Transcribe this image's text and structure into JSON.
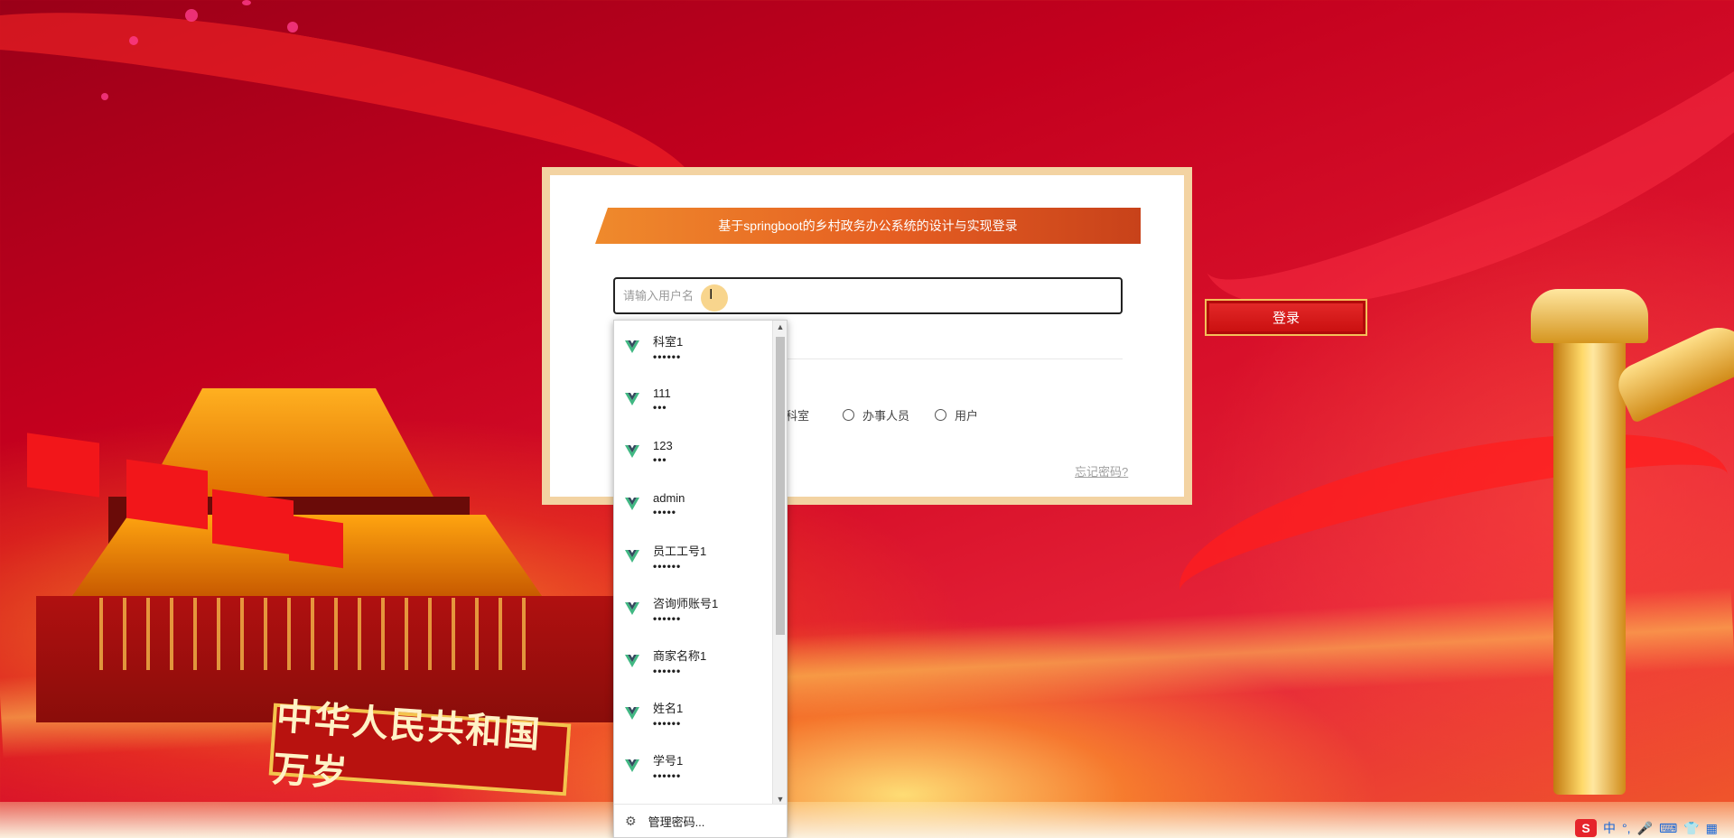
{
  "card": {
    "title": "基于springboot的乡村政务办公系统的设计与实现登录",
    "username_placeholder": "请输入用户名",
    "forgot_password": "忘记密码?",
    "roles": {
      "partial_visible": "科室",
      "options": [
        "办事人员",
        "用户"
      ]
    }
  },
  "login_button": "登录",
  "autofill": {
    "items": [
      {
        "name": "科室1",
        "password_mask": "••••••"
      },
      {
        "name": "111",
        "password_mask": "•••"
      },
      {
        "name": "123",
        "password_mask": "•••"
      },
      {
        "name": "admin",
        "password_mask": "•••••"
      },
      {
        "name": "员工工号1",
        "password_mask": "••••••"
      },
      {
        "name": "咨询师账号1",
        "password_mask": "••••••"
      },
      {
        "name": "商家名称1",
        "password_mask": "••••••"
      },
      {
        "name": "姓名1",
        "password_mask": "••••••"
      },
      {
        "name": "学号1",
        "password_mask": "••••••"
      }
    ],
    "manage_label": "管理密码...",
    "icon_color": "#41b883"
  },
  "background": {
    "plaque_text": "中华人民共和国万岁"
  },
  "tray": {
    "ime_logo": "S",
    "ime_lang": "中",
    "ime_punct": "°,"
  },
  "colors": {
    "title_bar": "#e55e22",
    "card_border": "#f3d3a2",
    "login_button": "#d81818"
  }
}
